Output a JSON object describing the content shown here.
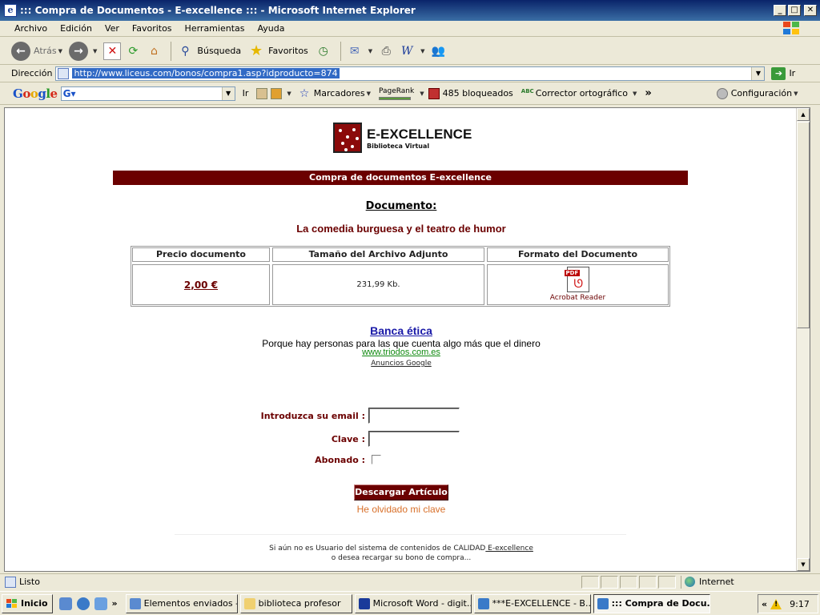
{
  "window": {
    "title": "::: Compra de Documentos - E-excellence ::: - Microsoft Internet Explorer"
  },
  "menu": [
    "Archivo",
    "Edición",
    "Ver",
    "Favoritos",
    "Herramientas",
    "Ayuda"
  ],
  "toolbar": {
    "back": "Atrás",
    "search": "Búsqueda",
    "favorites": "Favoritos"
  },
  "address": {
    "label": "Dirección",
    "url": "http://www.liceus.com/bonos/compra1.asp?idproducto=874",
    "go": "Ir"
  },
  "google_bar": {
    "logo": "Google",
    "go": "Ir",
    "bookmarks": "Marcadores",
    "pagerank": "PageRank",
    "blocked": "485 bloqueados",
    "spell": "Corrector ortográfico",
    "more": "»",
    "settings": "Configuración"
  },
  "page": {
    "logo_title": "E-EXCELLENCE",
    "logo_subtitle": "Biblioteca Virtual",
    "banner": "Compra de documentos E-excellence",
    "doc_label": "Documento:",
    "doc_title": "La comedia burguesa y el teatro de humor",
    "table": {
      "headers": [
        "Precio documento",
        "Tamaño del Archivo Adjunto",
        "Formato del Documento"
      ],
      "price": "2,00 €",
      "size": "231,99 Kb.",
      "format": "Acrobat Reader"
    },
    "ad": {
      "title": "Banca ética",
      "text": "Porque hay personas para las que cuenta algo más que el dinero",
      "url": "www.triodos.com.es",
      "google": "Anuncios Google"
    },
    "form": {
      "email_label": "Introduzca su email :",
      "password_label": "Clave :",
      "subscriber_label": "Abonado :",
      "submit": "Descargar Artículo",
      "forgot": "He olvidado mi clave"
    },
    "footer": {
      "line1_prefix": "Si aún no es Usuario del sistema de contenidos de CALIDAD",
      "line1_link": " E-excellence",
      "line2": "o desea recargar su bono de compra..."
    }
  },
  "status": {
    "text": "Listo",
    "zone": "Internet"
  },
  "taskbar": {
    "start": "Inicio",
    "tasks": [
      "Elementos enviados -...",
      "biblioteca profesor",
      "Microsoft Word - digit...",
      "***E-EXCELLENCE - B...",
      "::: Compra de Docu..."
    ],
    "clock": "9:17"
  }
}
